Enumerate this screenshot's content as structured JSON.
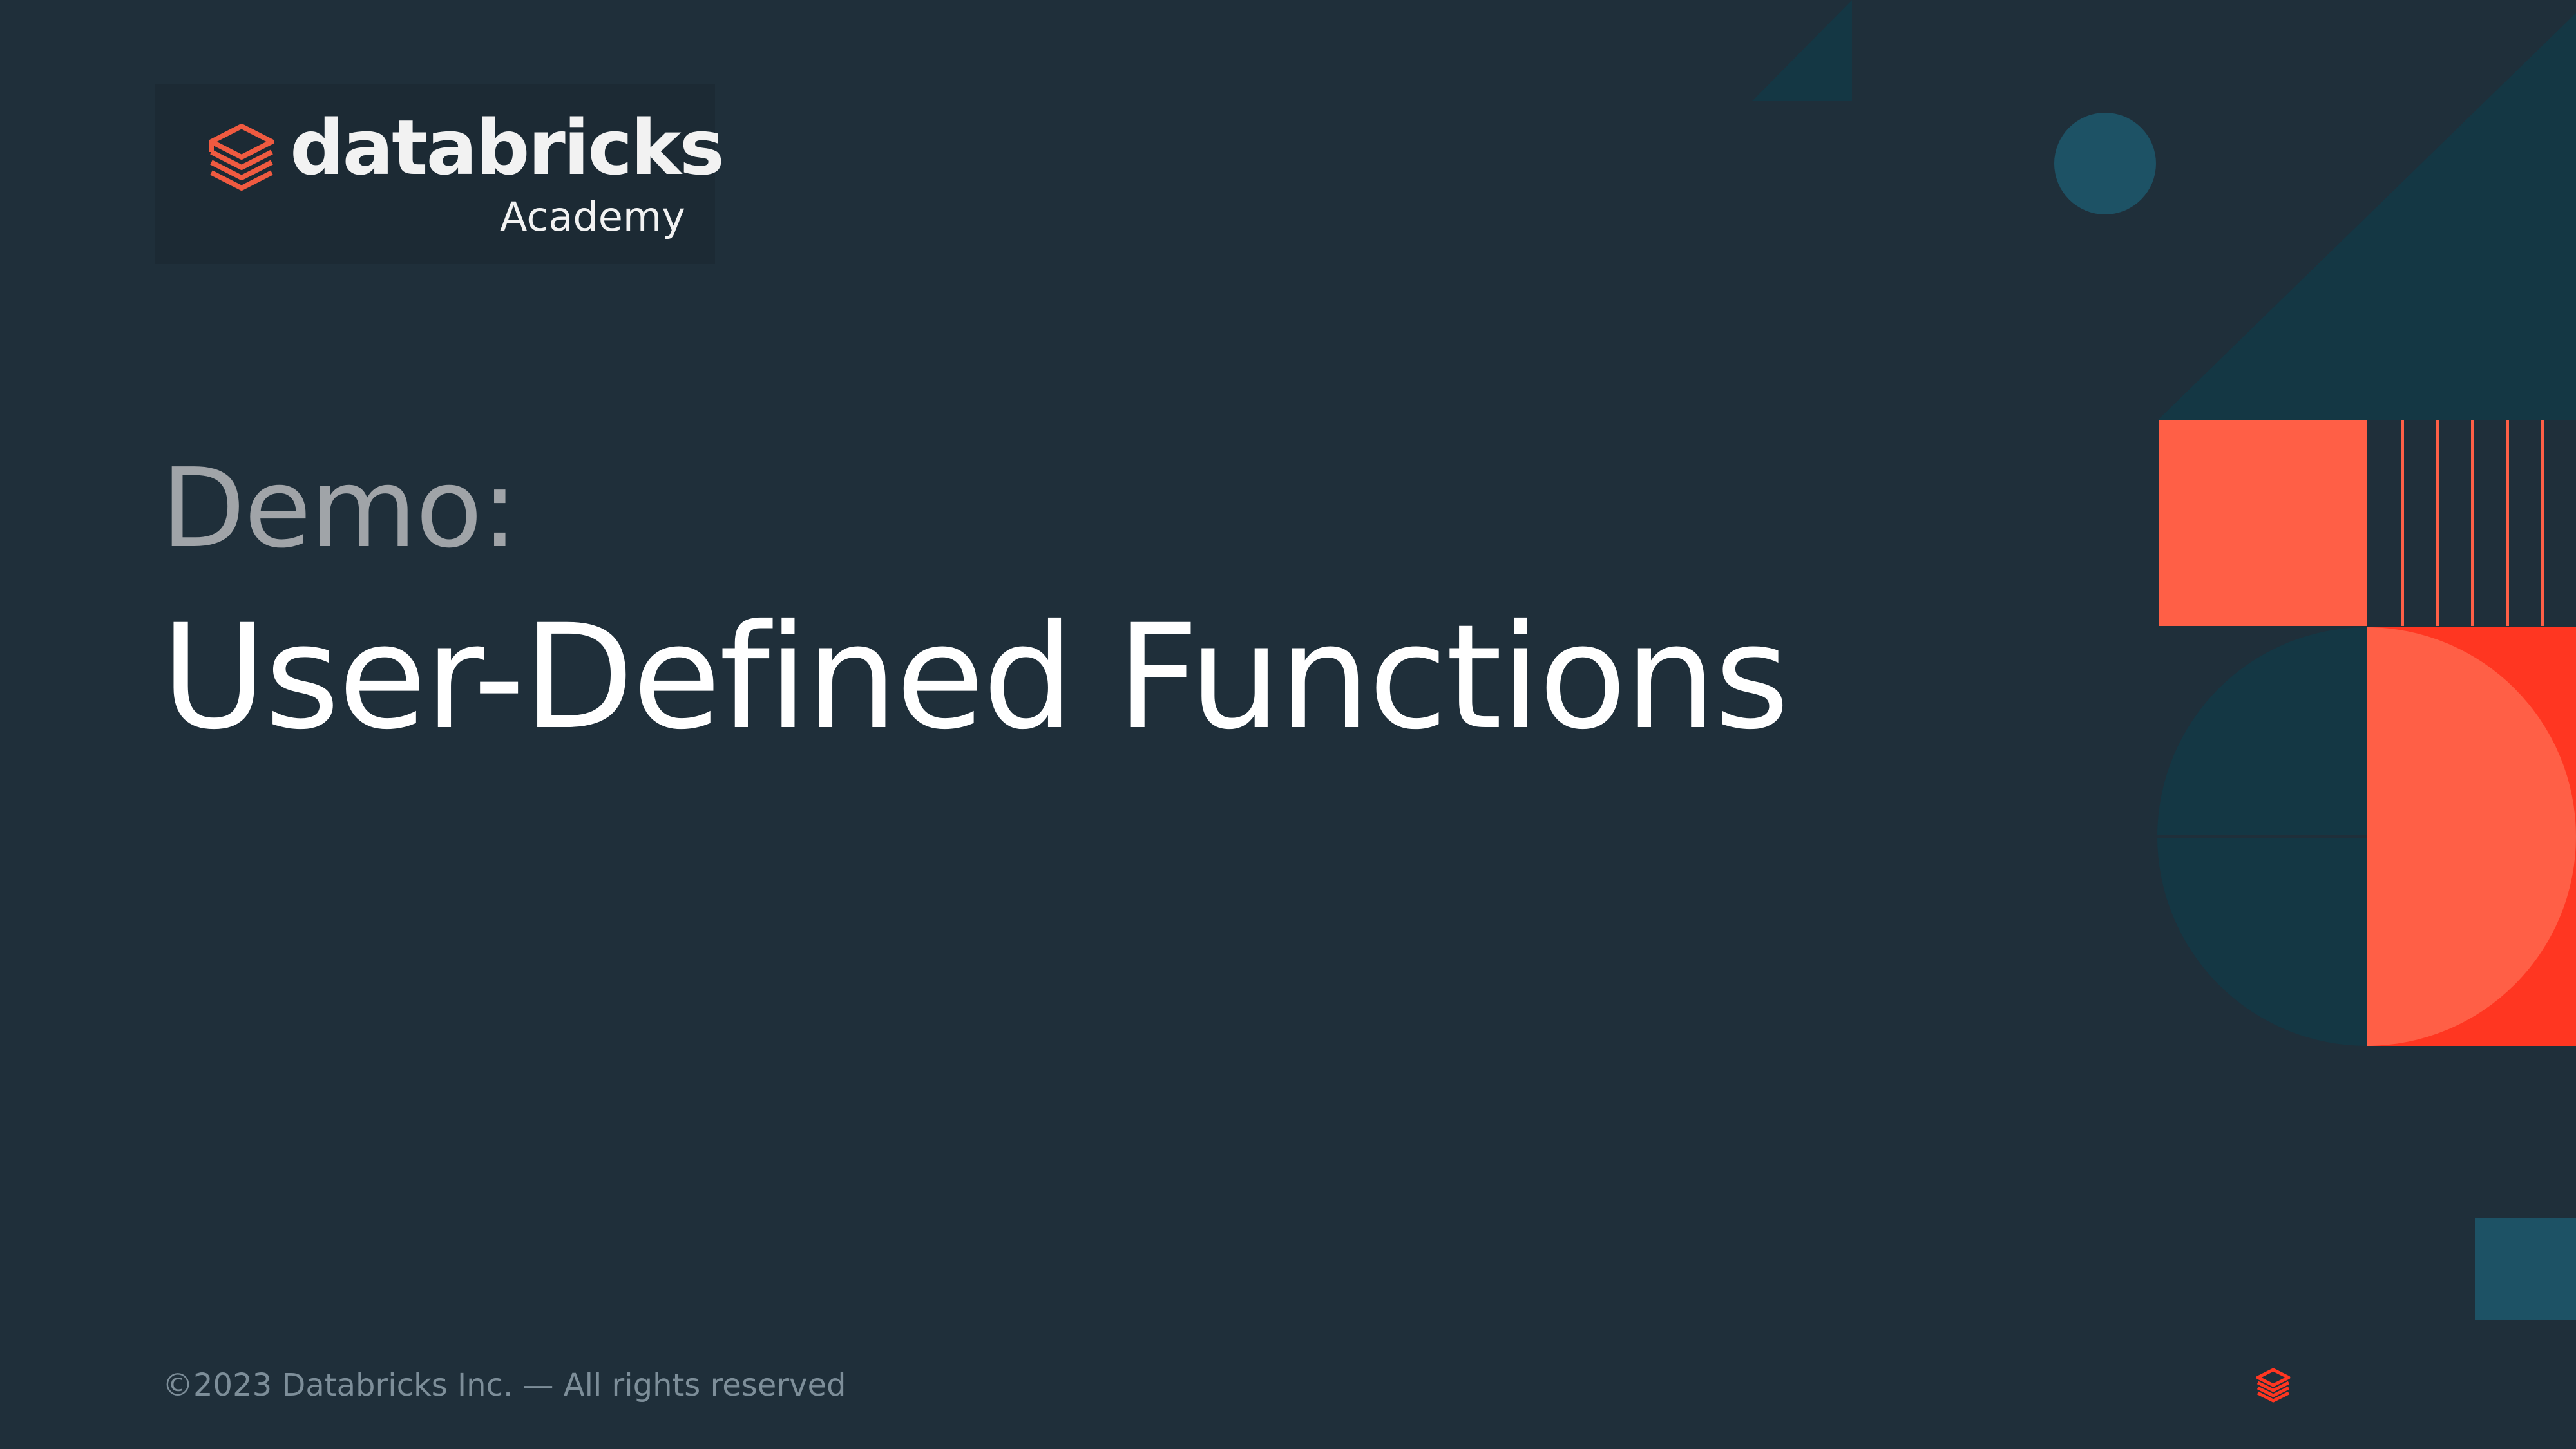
{
  "slide": {
    "logo": {
      "wordmark": "databricks",
      "subtitle": "Academy",
      "mark_icon": "databricks-stack-icon"
    },
    "label": "Demo:",
    "title": "User-Defined Functions",
    "footer": "©2023 Databricks Inc. — All rights reserved",
    "corner_icon": "databricks-stack-icon"
  },
  "colors": {
    "background": "#1f2f3a",
    "accent_orange": "#ff5f46",
    "accent_red": "#ff3621",
    "deep_teal": "#143744",
    "muted_teal": "#1d5265"
  }
}
